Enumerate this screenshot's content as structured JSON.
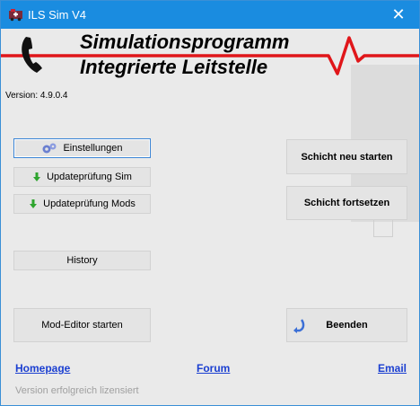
{
  "window": {
    "title": "ILS Sim V4",
    "close_glyph": "✕"
  },
  "header": {
    "line1": "Simulationsprogramm",
    "line2": "Integrierte Leitstelle",
    "version": "Version: 4.9.0.4"
  },
  "buttons": {
    "settings": "Einstellungen",
    "update_sim": "Updateprüfung Sim",
    "update_mods": "Updateprüfung Mods",
    "history": "History",
    "mod_editor": "Mod-Editor starten",
    "new_shift": "Schicht neu starten",
    "continue_shift": "Schicht fortsetzen",
    "quit": "Beenden"
  },
  "links": {
    "homepage": "Homepage",
    "forum": "Forum",
    "email": "Email"
  },
  "status": {
    "license": "Version erfolgreich lizensiert"
  },
  "icons": {
    "app": "ambulance-icon",
    "phone": "phone-icon",
    "settings": "gears-icon",
    "update": "arrow-down-icon",
    "quit": "return-arrow-icon"
  },
  "colors": {
    "titlebar": "#1a8ce0",
    "ekg_line": "#e0161a",
    "link": "#1b3fd1",
    "update_arrow": "#2fa52f"
  }
}
